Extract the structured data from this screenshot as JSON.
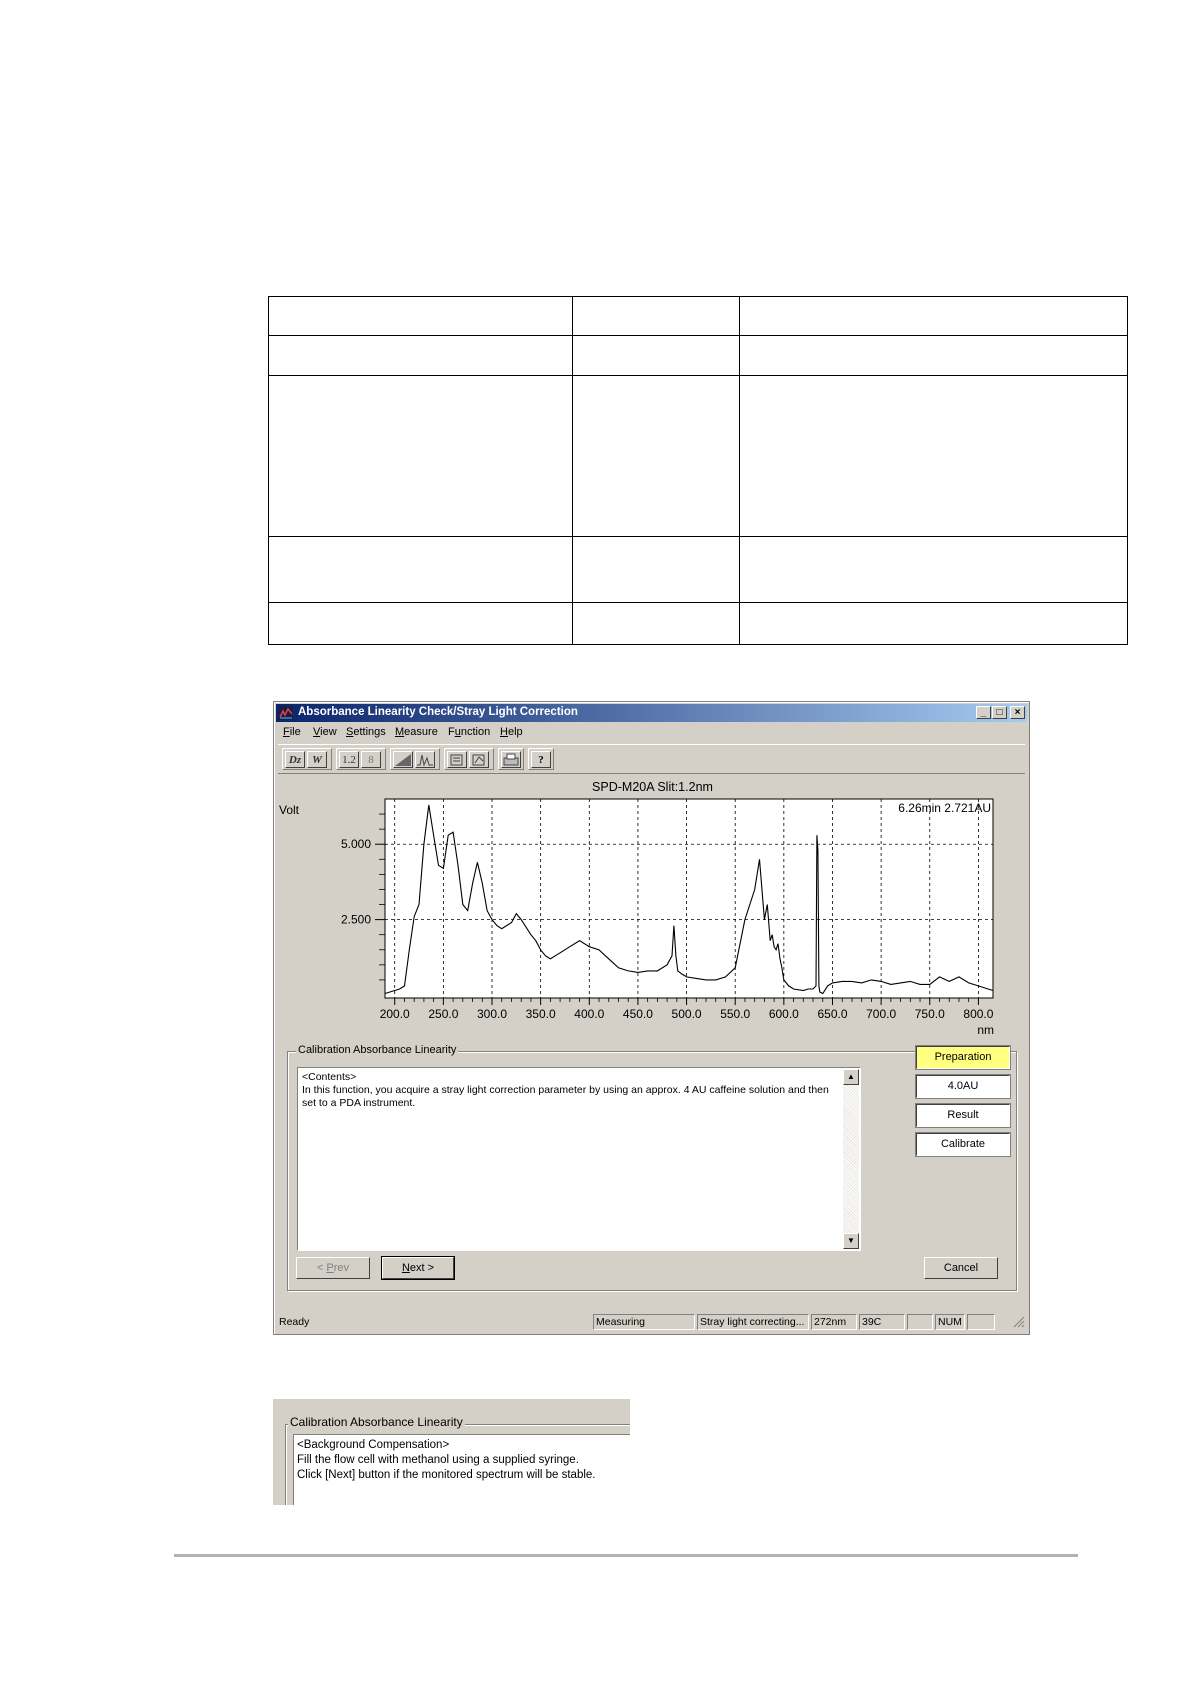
{
  "window": {
    "title": "Absorbance Linearity Check/Stray Light Correction",
    "caption_buttons": [
      "_",
      "□",
      "×"
    ],
    "menu": [
      {
        "label": "File",
        "mnemonic": "F",
        "rest": "ile"
      },
      {
        "label": "View",
        "mnemonic": "V",
        "rest": "iew"
      },
      {
        "label": "Settings",
        "mnemonic": "S",
        "rest": "ettings"
      },
      {
        "label": "Measure",
        "mnemonic": "M",
        "rest": "easure"
      },
      {
        "label": "Function",
        "mnemonic": "u",
        "pre": "F",
        "rest": "nction"
      },
      {
        "label": "Help",
        "mnemonic": "H",
        "rest": "elp"
      }
    ],
    "toolbar_icons": [
      "dz-icon",
      "w-icon",
      "decimal-icon",
      "integer-icon",
      "area-icon",
      "peak-icon",
      "overlay-icon",
      "overlay-active-icon",
      "print-icon",
      "help-icon"
    ],
    "toolbar_glyphs": {
      "dz": "Dz",
      "w": "W",
      "decimal": "1.2",
      "integer": "8",
      "help": "?"
    }
  },
  "chart_data": {
    "type": "line",
    "title": "SPD-M20A  Slit:1.2nm",
    "ylabel": "Volt",
    "xlabel": "nm",
    "xlim": [
      190,
      815
    ],
    "ylim": [
      -0.1,
      6.5
    ],
    "y_ticks": [
      "5.000",
      "2.500"
    ],
    "y_tick_values": [
      5.0,
      2.5
    ],
    "x_ticks": [
      "200.0",
      "250.0",
      "300.0",
      "350.0",
      "400.0",
      "450.0",
      "500.0",
      "550.0",
      "600.0",
      "650.0",
      "700.0",
      "750.0",
      "800.0"
    ],
    "x_tick_values": [
      200,
      250,
      300,
      350,
      400,
      450,
      500,
      550,
      600,
      650,
      700,
      750,
      800
    ],
    "readout": "6.26min  2.721AU",
    "grid": true,
    "series": [
      {
        "x": [
          190,
          195,
          200,
          205,
          210,
          215,
          220,
          225,
          230,
          235,
          240,
          245,
          250,
          255,
          260,
          265,
          270,
          275,
          280,
          285,
          290,
          295,
          300,
          305,
          310,
          315,
          320,
          325,
          330,
          340,
          345,
          350,
          355,
          360,
          365,
          370,
          380,
          390,
          400,
          410,
          420,
          430,
          440,
          450,
          460,
          470,
          480,
          485,
          487,
          489,
          491,
          495,
          500,
          510,
          520,
          530,
          540,
          550,
          560,
          570,
          575,
          580,
          583,
          586,
          588,
          590,
          592,
          594,
          596,
          598,
          600,
          605,
          610,
          620,
          625,
          630,
          633,
          634,
          635,
          636,
          637,
          640,
          645,
          650,
          660,
          670,
          680,
          690,
          700,
          710,
          720,
          730,
          740,
          750,
          760,
          770,
          780,
          790,
          800,
          810,
          815
        ],
        "y": [
          0.05,
          0.1,
          0.15,
          0.2,
          0.3,
          1.5,
          2.6,
          3.0,
          5.0,
          6.3,
          5.3,
          4.3,
          4.2,
          5.3,
          5.4,
          4.3,
          3.0,
          2.8,
          3.7,
          4.4,
          3.7,
          2.8,
          2.5,
          2.3,
          2.2,
          2.3,
          2.4,
          2.7,
          2.5,
          2.0,
          1.8,
          1.5,
          1.3,
          1.2,
          1.3,
          1.4,
          1.6,
          1.8,
          1.6,
          1.5,
          1.2,
          0.9,
          0.8,
          0.75,
          0.8,
          0.8,
          1.0,
          1.3,
          2.3,
          1.3,
          0.8,
          0.7,
          0.6,
          0.55,
          0.5,
          0.5,
          0.6,
          0.9,
          2.5,
          3.5,
          4.5,
          2.5,
          3.0,
          1.8,
          2.0,
          1.6,
          1.5,
          1.7,
          1.2,
          0.9,
          0.5,
          0.3,
          0.2,
          0.15,
          0.2,
          0.2,
          0.3,
          5.3,
          4.8,
          0.3,
          0.1,
          0.05,
          0.3,
          0.4,
          0.45,
          0.45,
          0.4,
          0.5,
          0.45,
          0.35,
          0.4,
          0.45,
          0.35,
          0.35,
          0.6,
          0.45,
          0.6,
          0.4,
          0.3,
          0.2,
          0.15
        ]
      }
    ]
  },
  "group": {
    "label": "Calibration Absorbance Linearity",
    "text_lines": [
      "<Contents>",
      "In this function, you acquire a stray light correction parameter by using an approx. 4 AU caffeine solution and then set to a PDA instrument."
    ],
    "steps": [
      {
        "label": "Preparation",
        "active": true
      },
      {
        "label": "4.0AU",
        "active": false
      },
      {
        "label": "Result",
        "active": false
      },
      {
        "label": "Calibrate",
        "active": false
      }
    ],
    "prev": {
      "pre": "< ",
      "ul": "P",
      "rest": "rev"
    },
    "next": {
      "ul": "N",
      "rest": "ext >"
    },
    "cancel": "Cancel"
  },
  "status": {
    "ready": "Ready",
    "measuring": "Measuring",
    "stage": "Stray light correcting...",
    "wavelength": "272nm",
    "temp": "39C",
    "blank": "",
    "num": "NUM"
  },
  "snippet": {
    "label": "Calibration Absorbance Linearity",
    "lines": [
      "<Background Compensation>",
      "Fill the flow cell with methanol using a supplied syringe.",
      "Click [Next] button if the monitored spectrum will be stable."
    ]
  }
}
